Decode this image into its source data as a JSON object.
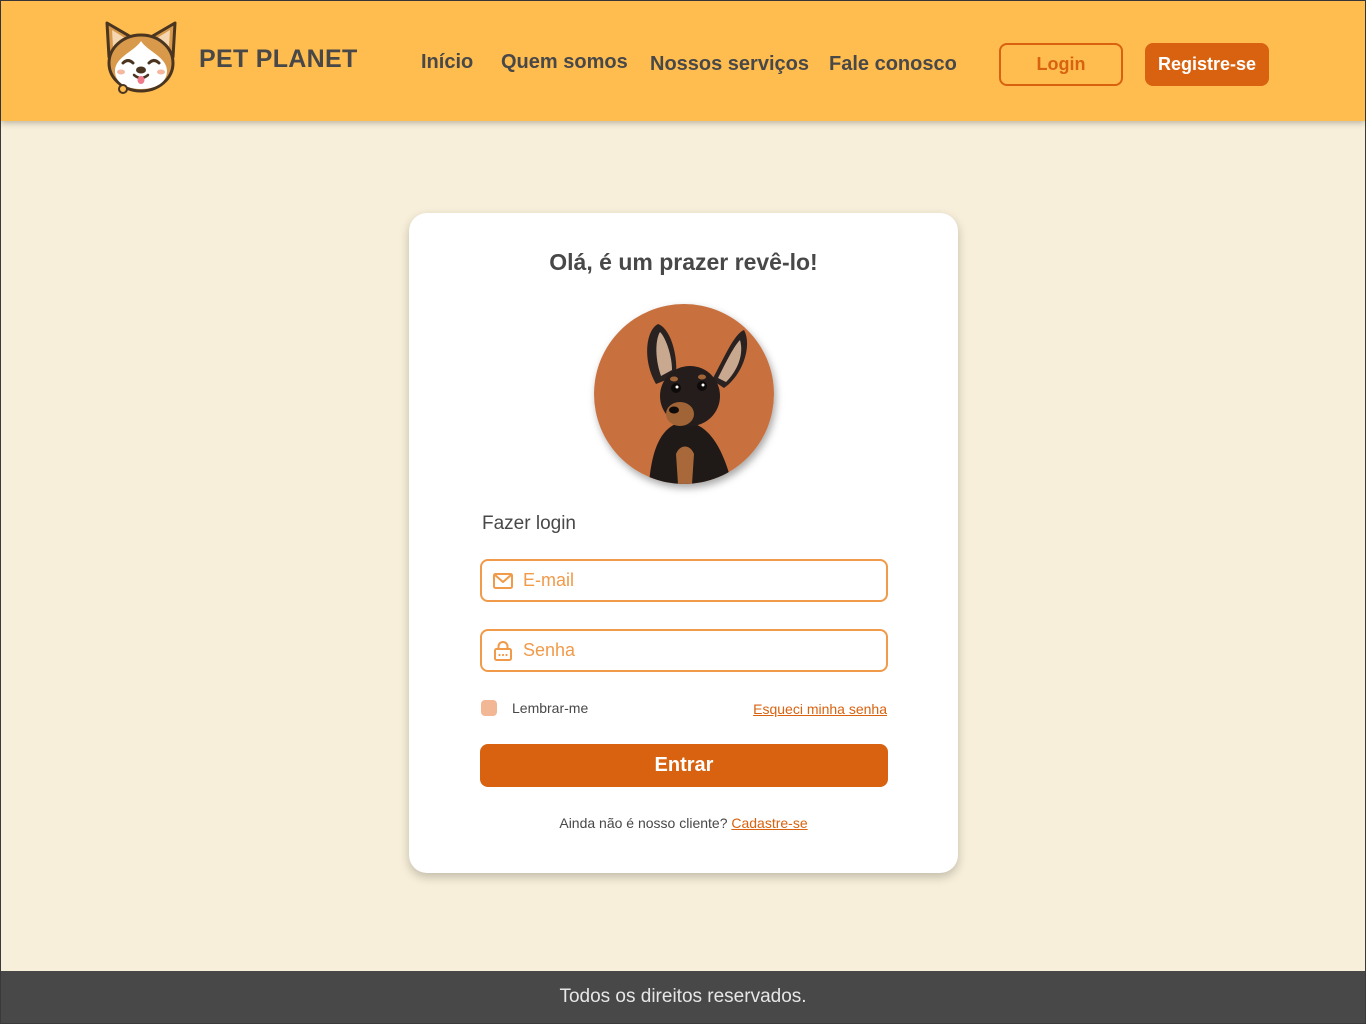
{
  "colors": {
    "header_bg": "#ffbd4f",
    "page_bg": "#f7efd9",
    "accent": "#d8620f",
    "input_accent": "#f09a4a",
    "text_dark": "#484848",
    "footer_bg": "#484848"
  },
  "header": {
    "logo_icon": "corgi-dog-logo-icon",
    "brand": "PET PLANET",
    "nav": [
      {
        "label": "Início"
      },
      {
        "label": "Quem somos"
      },
      {
        "label": "Nossos serviços"
      },
      {
        "label": "Fale conosco"
      }
    ],
    "login_label": "Login",
    "register_label": "Registre-se"
  },
  "card": {
    "title": "Olá, é um prazer revê-lo!",
    "avatar_icon": "dog-photo",
    "section_label": "Fazer login",
    "email": {
      "icon": "mail-icon",
      "placeholder": "E-mail",
      "value": ""
    },
    "password": {
      "icon": "lock-icon",
      "placeholder": "Senha",
      "value": ""
    },
    "remember_label": "Lembrar-me",
    "forgot_label": "Esqueci minha senha",
    "submit_label": "Entrar",
    "signup_prompt": "Ainda não é nosso cliente?",
    "signup_link": "Cadastre-se"
  },
  "footer": {
    "text": "Todos os direitos reservados."
  }
}
